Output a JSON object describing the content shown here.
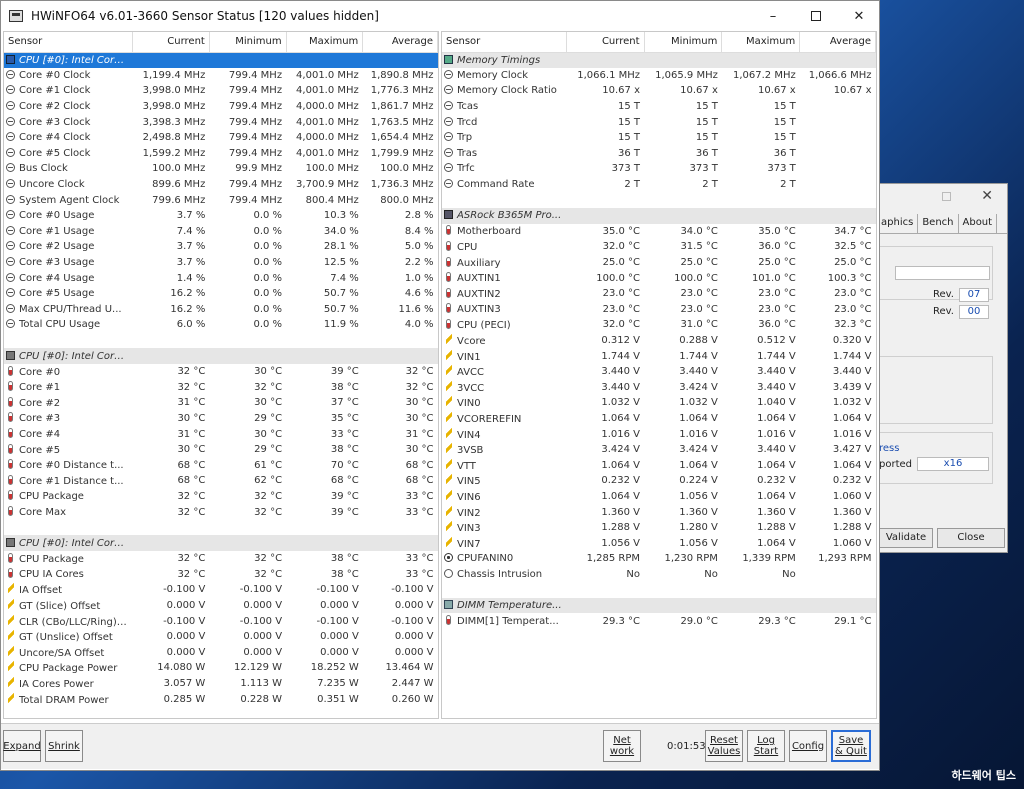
{
  "window": {
    "title": "HWiNFO64 v6.01-3660 Sensor Status [120 values hidden]",
    "minimize_glyph": "–",
    "close_glyph": "✕"
  },
  "columns": [
    "Sensor",
    "Current",
    "Minimum",
    "Maximum",
    "Average"
  ],
  "left_rows": [
    {
      "type": "header",
      "selected": true,
      "icon": "cpu-icon",
      "label": "CPU [#0]: Intel Core..."
    },
    {
      "icon": "clock-icon",
      "label": "Core #0 Clock",
      "cur": "1,199.4 MHz",
      "min": "799.4 MHz",
      "max": "4,001.0 MHz",
      "avg": "1,890.8 MHz"
    },
    {
      "icon": "clock-icon",
      "label": "Core #1 Clock",
      "cur": "3,998.0 MHz",
      "min": "799.4 MHz",
      "max": "4,001.0 MHz",
      "avg": "1,776.3 MHz"
    },
    {
      "icon": "clock-icon",
      "label": "Core #2 Clock",
      "cur": "3,998.0 MHz",
      "min": "799.4 MHz",
      "max": "4,000.0 MHz",
      "avg": "1,861.7 MHz"
    },
    {
      "icon": "clock-icon",
      "label": "Core #3 Clock",
      "cur": "3,398.3 MHz",
      "min": "799.4 MHz",
      "max": "4,001.0 MHz",
      "avg": "1,763.5 MHz"
    },
    {
      "icon": "clock-icon",
      "label": "Core #4 Clock",
      "cur": "2,498.8 MHz",
      "min": "799.4 MHz",
      "max": "4,000.0 MHz",
      "avg": "1,654.4 MHz"
    },
    {
      "icon": "clock-icon",
      "label": "Core #5 Clock",
      "cur": "1,599.2 MHz",
      "min": "799.4 MHz",
      "max": "4,001.0 MHz",
      "avg": "1,799.9 MHz"
    },
    {
      "icon": "clock-icon",
      "label": "Bus Clock",
      "cur": "100.0 MHz",
      "min": "99.9 MHz",
      "max": "100.0 MHz",
      "avg": "100.0 MHz"
    },
    {
      "icon": "clock-icon",
      "label": "Uncore Clock",
      "cur": "899.6 MHz",
      "min": "799.4 MHz",
      "max": "3,700.9 MHz",
      "avg": "1,736.3 MHz"
    },
    {
      "icon": "clock-icon",
      "label": "System Agent Clock",
      "cur": "799.6 MHz",
      "min": "799.4 MHz",
      "max": "800.4 MHz",
      "avg": "800.0 MHz"
    },
    {
      "icon": "clock-icon",
      "label": "Core #0 Usage",
      "cur": "3.7 %",
      "min": "0.0 %",
      "max": "10.3 %",
      "avg": "2.8 %"
    },
    {
      "icon": "clock-icon",
      "label": "Core #1 Usage",
      "cur": "7.4 %",
      "min": "0.0 %",
      "max": "34.0 %",
      "avg": "8.4 %"
    },
    {
      "icon": "clock-icon",
      "label": "Core #2 Usage",
      "cur": "3.7 %",
      "min": "0.0 %",
      "max": "28.1 %",
      "avg": "5.0 %"
    },
    {
      "icon": "clock-icon",
      "label": "Core #3 Usage",
      "cur": "3.7 %",
      "min": "0.0 %",
      "max": "12.5 %",
      "avg": "2.2 %"
    },
    {
      "icon": "clock-icon",
      "label": "Core #4 Usage",
      "cur": "1.4 %",
      "min": "0.0 %",
      "max": "7.4 %",
      "avg": "1.0 %"
    },
    {
      "icon": "clock-icon",
      "label": "Core #5 Usage",
      "cur": "16.2 %",
      "min": "0.0 %",
      "max": "50.7 %",
      "avg": "4.6 %"
    },
    {
      "icon": "clock-icon",
      "label": "Max CPU/Thread U...",
      "cur": "16.2 %",
      "min": "0.0 %",
      "max": "50.7 %",
      "avg": "11.6 %"
    },
    {
      "icon": "clock-icon",
      "label": "Total CPU Usage",
      "cur": "6.0 %",
      "min": "0.0 %",
      "max": "11.9 %",
      "avg": "4.0 %"
    },
    {
      "type": "blank"
    },
    {
      "type": "header",
      "icon": "chip-icon",
      "label": "CPU [#0]: Intel Core..."
    },
    {
      "icon": "thermometer-icon",
      "label": "Core #0",
      "cur": "32 °C",
      "min": "30 °C",
      "max": "39 °C",
      "avg": "32 °C"
    },
    {
      "icon": "thermometer-icon",
      "label": "Core #1",
      "cur": "32 °C",
      "min": "32 °C",
      "max": "38 °C",
      "avg": "32 °C"
    },
    {
      "icon": "thermometer-icon",
      "label": "Core #2",
      "cur": "31 °C",
      "min": "30 °C",
      "max": "37 °C",
      "avg": "30 °C"
    },
    {
      "icon": "thermometer-icon",
      "label": "Core #3",
      "cur": "30 °C",
      "min": "29 °C",
      "max": "35 °C",
      "avg": "30 °C"
    },
    {
      "icon": "thermometer-icon",
      "label": "Core #4",
      "cur": "31 °C",
      "min": "30 °C",
      "max": "33 °C",
      "avg": "31 °C"
    },
    {
      "icon": "thermometer-icon",
      "label": "Core #5",
      "cur": "30 °C",
      "min": "29 °C",
      "max": "38 °C",
      "avg": "30 °C"
    },
    {
      "icon": "thermometer-icon",
      "label": "Core #0 Distance t...",
      "cur": "68 °C",
      "min": "61 °C",
      "max": "70 °C",
      "avg": "68 °C"
    },
    {
      "icon": "thermometer-icon",
      "label": "Core #1 Distance t...",
      "cur": "68 °C",
      "min": "62 °C",
      "max": "68 °C",
      "avg": "68 °C"
    },
    {
      "icon": "thermometer-icon",
      "label": "CPU Package",
      "cur": "32 °C",
      "min": "32 °C",
      "max": "39 °C",
      "avg": "33 °C"
    },
    {
      "icon": "thermometer-icon",
      "label": "Core Max",
      "cur": "32 °C",
      "min": "32 °C",
      "max": "39 °C",
      "avg": "33 °C"
    },
    {
      "type": "blank"
    },
    {
      "type": "header",
      "icon": "chip-icon",
      "label": "CPU [#0]: Intel Core..."
    },
    {
      "icon": "thermometer-icon",
      "label": "CPU Package",
      "cur": "32 °C",
      "min": "32 °C",
      "max": "38 °C",
      "avg": "33 °C"
    },
    {
      "icon": "thermometer-icon",
      "label": "CPU IA Cores",
      "cur": "32 °C",
      "min": "32 °C",
      "max": "38 °C",
      "avg": "33 °C"
    },
    {
      "icon": "voltage-icon",
      "label": "IA Offset",
      "cur": "-0.100 V",
      "min": "-0.100 V",
      "max": "-0.100 V",
      "avg": "-0.100 V"
    },
    {
      "icon": "voltage-icon",
      "label": "GT (Slice) Offset",
      "cur": "0.000 V",
      "min": "0.000 V",
      "max": "0.000 V",
      "avg": "0.000 V"
    },
    {
      "icon": "voltage-icon",
      "label": "CLR (CBo/LLC/Ring) ...",
      "cur": "-0.100 V",
      "min": "-0.100 V",
      "max": "-0.100 V",
      "avg": "-0.100 V"
    },
    {
      "icon": "voltage-icon",
      "label": "GT (Unslice) Offset",
      "cur": "0.000 V",
      "min": "0.000 V",
      "max": "0.000 V",
      "avg": "0.000 V"
    },
    {
      "icon": "voltage-icon",
      "label": "Uncore/SA Offset",
      "cur": "0.000 V",
      "min": "0.000 V",
      "max": "0.000 V",
      "avg": "0.000 V"
    },
    {
      "icon": "voltage-icon",
      "label": "CPU Package Power",
      "cur": "14.080 W",
      "min": "12.129 W",
      "max": "18.252 W",
      "avg": "13.464 W"
    },
    {
      "icon": "voltage-icon",
      "label": "IA Cores Power",
      "cur": "3.057 W",
      "min": "1.113 W",
      "max": "7.235 W",
      "avg": "2.447 W"
    },
    {
      "icon": "voltage-icon",
      "label": "Total DRAM Power",
      "cur": "0.285 W",
      "min": "0.228 W",
      "max": "0.351 W",
      "avg": "0.260 W"
    }
  ],
  "right_rows": [
    {
      "type": "header",
      "icon": "memory-icon",
      "label": "Memory Timings"
    },
    {
      "icon": "clock-icon",
      "label": "Memory Clock",
      "cur": "1,066.1 MHz",
      "min": "1,065.9 MHz",
      "max": "1,067.2 MHz",
      "avg": "1,066.6 MHz"
    },
    {
      "icon": "clock-icon",
      "label": "Memory Clock Ratio",
      "cur": "10.67 x",
      "min": "10.67 x",
      "max": "10.67 x",
      "avg": "10.67 x"
    },
    {
      "icon": "clock-icon",
      "label": "Tcas",
      "cur": "15 T",
      "min": "15 T",
      "max": "15 T",
      "avg": ""
    },
    {
      "icon": "clock-icon",
      "label": "Trcd",
      "cur": "15 T",
      "min": "15 T",
      "max": "15 T",
      "avg": ""
    },
    {
      "icon": "clock-icon",
      "label": "Trp",
      "cur": "15 T",
      "min": "15 T",
      "max": "15 T",
      "avg": ""
    },
    {
      "icon": "clock-icon",
      "label": "Tras",
      "cur": "36 T",
      "min": "36 T",
      "max": "36 T",
      "avg": ""
    },
    {
      "icon": "clock-icon",
      "label": "Trfc",
      "cur": "373 T",
      "min": "373 T",
      "max": "373 T",
      "avg": ""
    },
    {
      "icon": "clock-icon",
      "label": "Command Rate",
      "cur": "2 T",
      "min": "2 T",
      "max": "2 T",
      "avg": ""
    },
    {
      "type": "blank"
    },
    {
      "type": "header",
      "icon": "board-icon",
      "label": "ASRock B365M Pro..."
    },
    {
      "icon": "thermometer-icon",
      "label": "Motherboard",
      "cur": "35.0 °C",
      "min": "34.0 °C",
      "max": "35.0 °C",
      "avg": "34.7 °C"
    },
    {
      "icon": "thermometer-icon",
      "label": "CPU",
      "cur": "32.0 °C",
      "min": "31.5 °C",
      "max": "36.0 °C",
      "avg": "32.5 °C"
    },
    {
      "icon": "thermometer-icon",
      "label": "Auxiliary",
      "cur": "25.0 °C",
      "min": "25.0 °C",
      "max": "25.0 °C",
      "avg": "25.0 °C"
    },
    {
      "icon": "thermometer-icon",
      "label": "AUXTIN1",
      "cur": "100.0 °C",
      "min": "100.0 °C",
      "max": "101.0 °C",
      "avg": "100.3 °C"
    },
    {
      "icon": "thermometer-icon",
      "label": "AUXTIN2",
      "cur": "23.0 °C",
      "min": "23.0 °C",
      "max": "23.0 °C",
      "avg": "23.0 °C"
    },
    {
      "icon": "thermometer-icon",
      "label": "AUXTIN3",
      "cur": "23.0 °C",
      "min": "23.0 °C",
      "max": "23.0 °C",
      "avg": "23.0 °C"
    },
    {
      "icon": "thermometer-icon",
      "label": "CPU (PECI)",
      "cur": "32.0 °C",
      "min": "31.0 °C",
      "max": "36.0 °C",
      "avg": "32.3 °C"
    },
    {
      "icon": "voltage-icon",
      "label": "Vcore",
      "cur": "0.312 V",
      "min": "0.288 V",
      "max": "0.512 V",
      "avg": "0.320 V"
    },
    {
      "icon": "voltage-icon",
      "label": "VIN1",
      "cur": "1.744 V",
      "min": "1.744 V",
      "max": "1.744 V",
      "avg": "1.744 V"
    },
    {
      "icon": "voltage-icon",
      "label": "AVCC",
      "cur": "3.440 V",
      "min": "3.440 V",
      "max": "3.440 V",
      "avg": "3.440 V"
    },
    {
      "icon": "voltage-icon",
      "label": "3VCC",
      "cur": "3.440 V",
      "min": "3.424 V",
      "max": "3.440 V",
      "avg": "3.439 V"
    },
    {
      "icon": "voltage-icon",
      "label": "VIN0",
      "cur": "1.032 V",
      "min": "1.032 V",
      "max": "1.040 V",
      "avg": "1.032 V"
    },
    {
      "icon": "voltage-icon",
      "label": "VCOREREFIN",
      "cur": "1.064 V",
      "min": "1.064 V",
      "max": "1.064 V",
      "avg": "1.064 V"
    },
    {
      "icon": "voltage-icon",
      "label": "VIN4",
      "cur": "1.016 V",
      "min": "1.016 V",
      "max": "1.016 V",
      "avg": "1.016 V"
    },
    {
      "icon": "voltage-icon",
      "label": "3VSB",
      "cur": "3.424 V",
      "min": "3.424 V",
      "max": "3.440 V",
      "avg": "3.427 V"
    },
    {
      "icon": "voltage-icon",
      "label": "VTT",
      "cur": "1.064 V",
      "min": "1.064 V",
      "max": "1.064 V",
      "avg": "1.064 V"
    },
    {
      "icon": "voltage-icon",
      "label": "VIN5",
      "cur": "0.232 V",
      "min": "0.224 V",
      "max": "0.232 V",
      "avg": "0.232 V"
    },
    {
      "icon": "voltage-icon",
      "label": "VIN6",
      "cur": "1.064 V",
      "min": "1.056 V",
      "max": "1.064 V",
      "avg": "1.060 V"
    },
    {
      "icon": "voltage-icon",
      "label": "VIN2",
      "cur": "1.360 V",
      "min": "1.360 V",
      "max": "1.360 V",
      "avg": "1.360 V"
    },
    {
      "icon": "voltage-icon",
      "label": "VIN3",
      "cur": "1.288 V",
      "min": "1.280 V",
      "max": "1.288 V",
      "avg": "1.288 V"
    },
    {
      "icon": "voltage-icon",
      "label": "VIN7",
      "cur": "1.056 V",
      "min": "1.056 V",
      "max": "1.064 V",
      "avg": "1.060 V"
    },
    {
      "icon": "fan-icon",
      "label": "CPUFANIN0",
      "cur": "1,285 RPM",
      "min": "1,230 RPM",
      "max": "1,339 RPM",
      "avg": "1,293 RPM"
    },
    {
      "icon": "other-icon",
      "label": "Chassis Intrusion",
      "cur": "No",
      "min": "No",
      "max": "No",
      "avg": ""
    },
    {
      "type": "blank"
    },
    {
      "type": "header",
      "icon": "dimm-icon",
      "label": "DIMM Temperature..."
    },
    {
      "icon": "thermometer-icon",
      "label": "DIMM[1] Temperat...",
      "cur": "29.3 °C",
      "min": "29.0 °C",
      "max": "29.3 °C",
      "avg": "29.1 °C"
    }
  ],
  "toolbar": {
    "expand": "Expand",
    "shrink": "Shrink",
    "network": "Net work",
    "timer": "0:01:53",
    "reset": "Reset Values",
    "log": "Log Start",
    "config": "Config",
    "save_quit": "Save & Quit"
  },
  "background_window": {
    "tabs": [
      "aphics",
      "Bench",
      "About"
    ],
    "rev_label": "Rev.",
    "rev1": "07",
    "rev2": "00",
    "text1": "ress",
    "text2": "ported",
    "value_x16": "x16",
    "validate": "Validate",
    "close": "Close"
  },
  "watermark": "하드웨어 팁스"
}
